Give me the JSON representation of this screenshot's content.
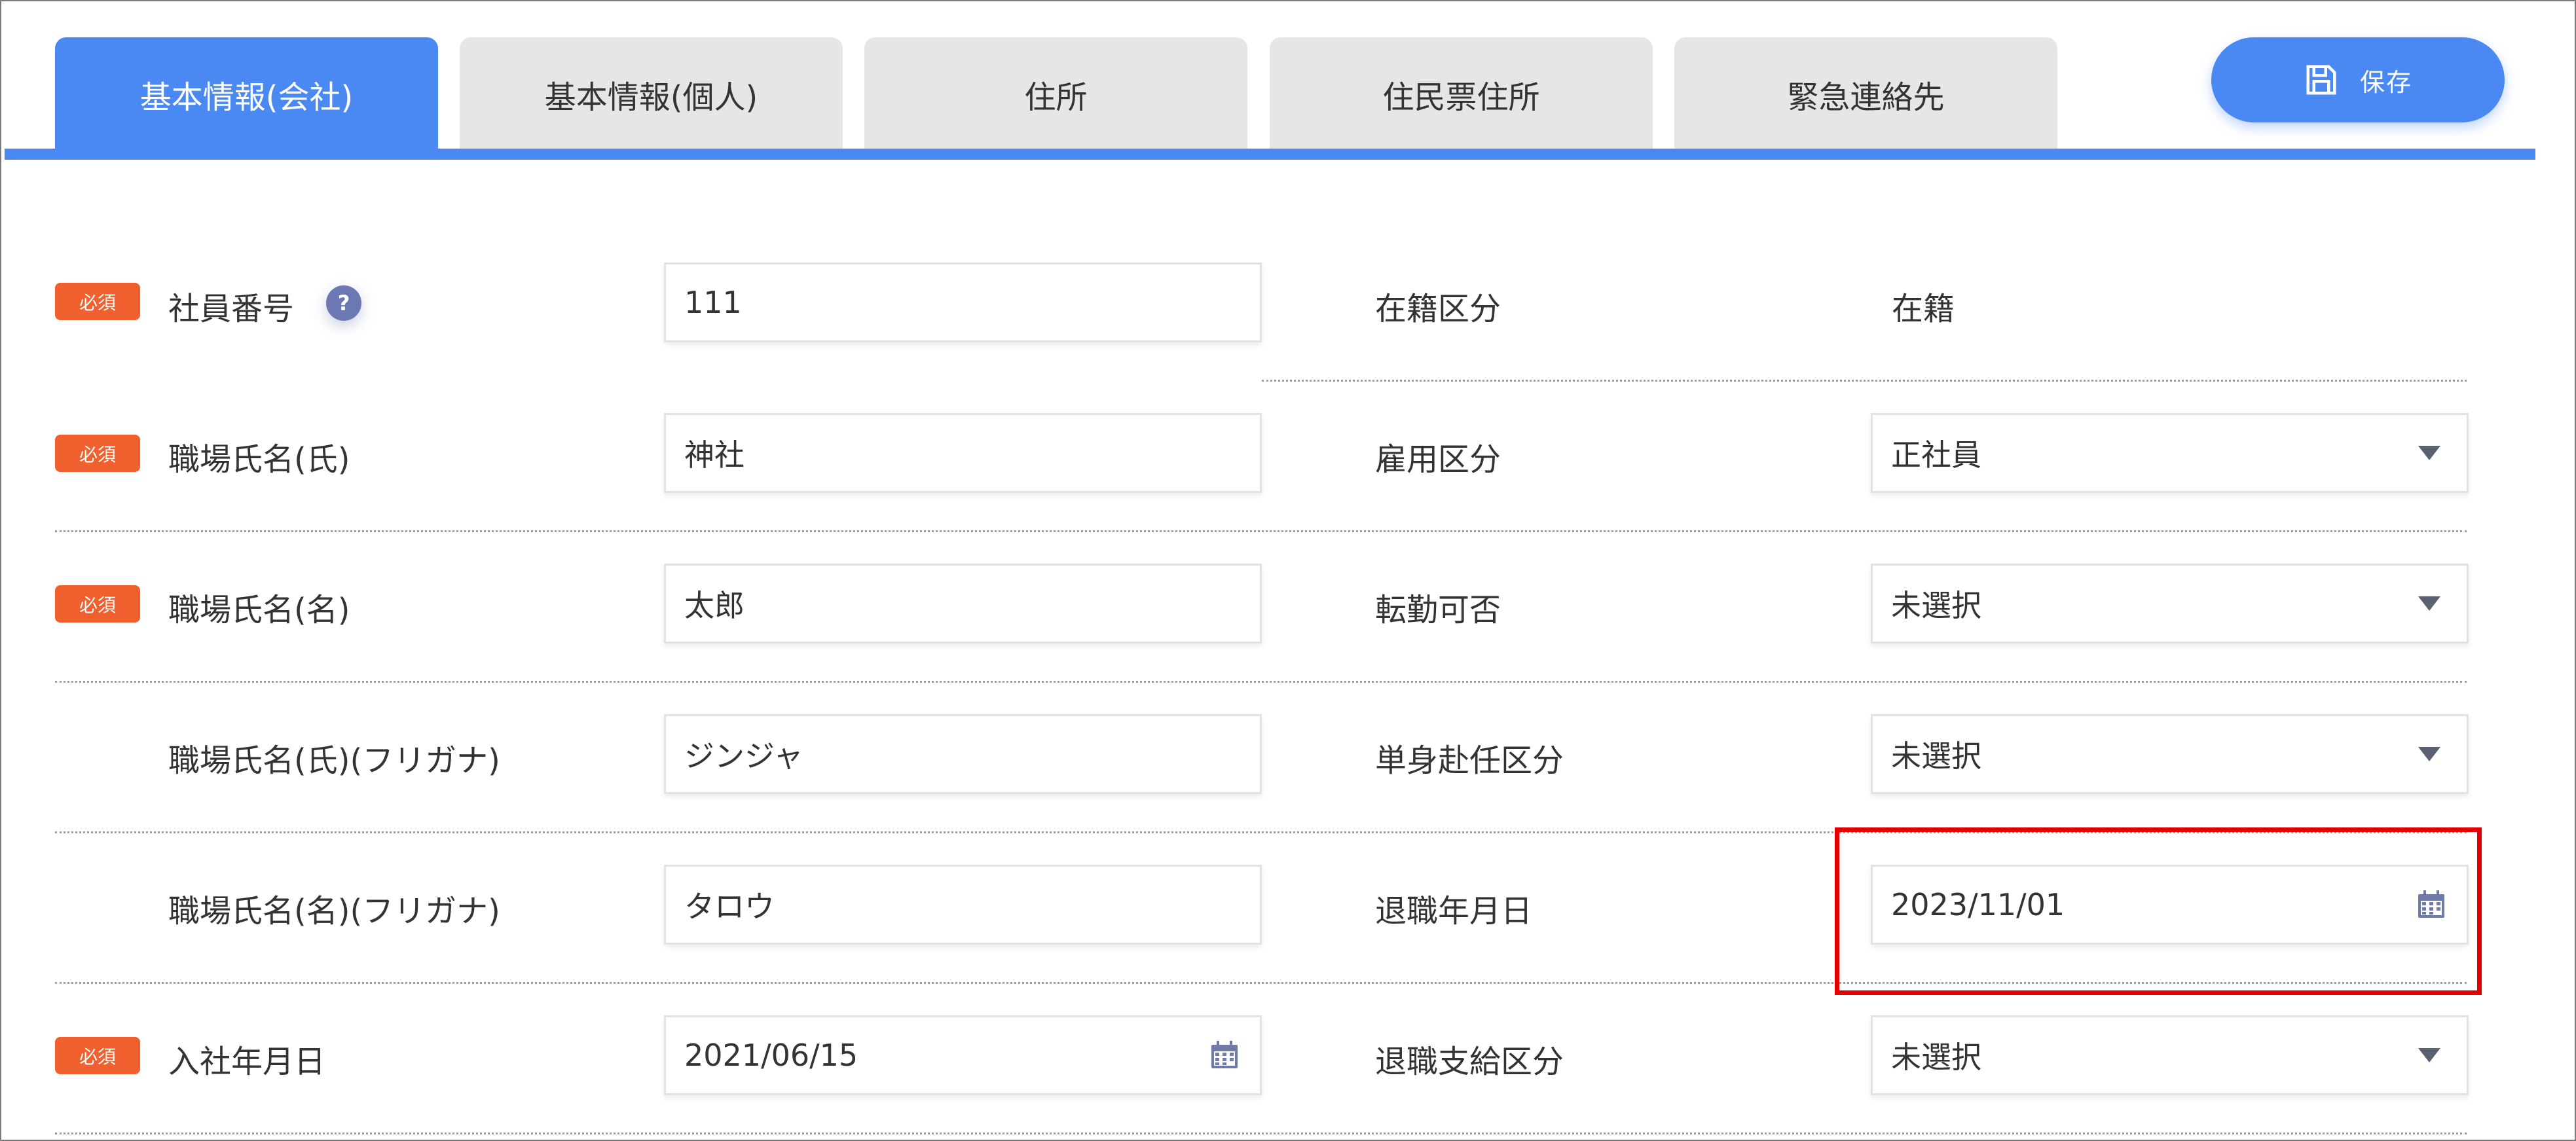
{
  "tabs": [
    {
      "label": "基本情報(会社)",
      "active": true
    },
    {
      "label": "基本情報(個人)",
      "active": false
    },
    {
      "label": "住所",
      "active": false
    },
    {
      "label": "住民票住所",
      "active": false
    },
    {
      "label": "緊急連絡先",
      "active": false
    }
  ],
  "toolbar": {
    "save_label": "保存"
  },
  "required_badge": "必須",
  "help_glyph": "?",
  "form": {
    "left": [
      {
        "label": "社員番号",
        "value": "111",
        "required": true
      },
      {
        "label": "職場氏名(氏)",
        "value": "神社",
        "required": true
      },
      {
        "label": "職場氏名(名)",
        "value": "太郎",
        "required": true
      },
      {
        "label": "職場氏名(氏)(フリガナ)",
        "value": "ジンジャ",
        "required": false
      },
      {
        "label": "職場氏名(名)(フリガナ)",
        "value": "タロウ",
        "required": false
      },
      {
        "label": "入社年月日",
        "value": "2021/06/15",
        "required": true
      }
    ],
    "right": [
      {
        "label": "在籍区分",
        "value": "在籍",
        "kind": "static"
      },
      {
        "label": "雇用区分",
        "value": "正社員",
        "kind": "select"
      },
      {
        "label": "転勤可否",
        "value": "未選択",
        "kind": "select"
      },
      {
        "label": "単身赴任区分",
        "value": "未選択",
        "kind": "select"
      },
      {
        "label": "退職年月日",
        "value": "2023/11/01",
        "kind": "date"
      },
      {
        "label": "退職支給区分",
        "value": "未選択",
        "kind": "select"
      }
    ]
  },
  "icons": {
    "save": "floppy-disk-icon",
    "calendar": "calendar-icon",
    "dropdown": "chevron-down-icon",
    "help": "question-icon"
  },
  "colors": {
    "accent": "#4a88f2",
    "required": "#f0602f",
    "highlight": "#e40000",
    "tab_inactive": "#e6e6e6"
  }
}
